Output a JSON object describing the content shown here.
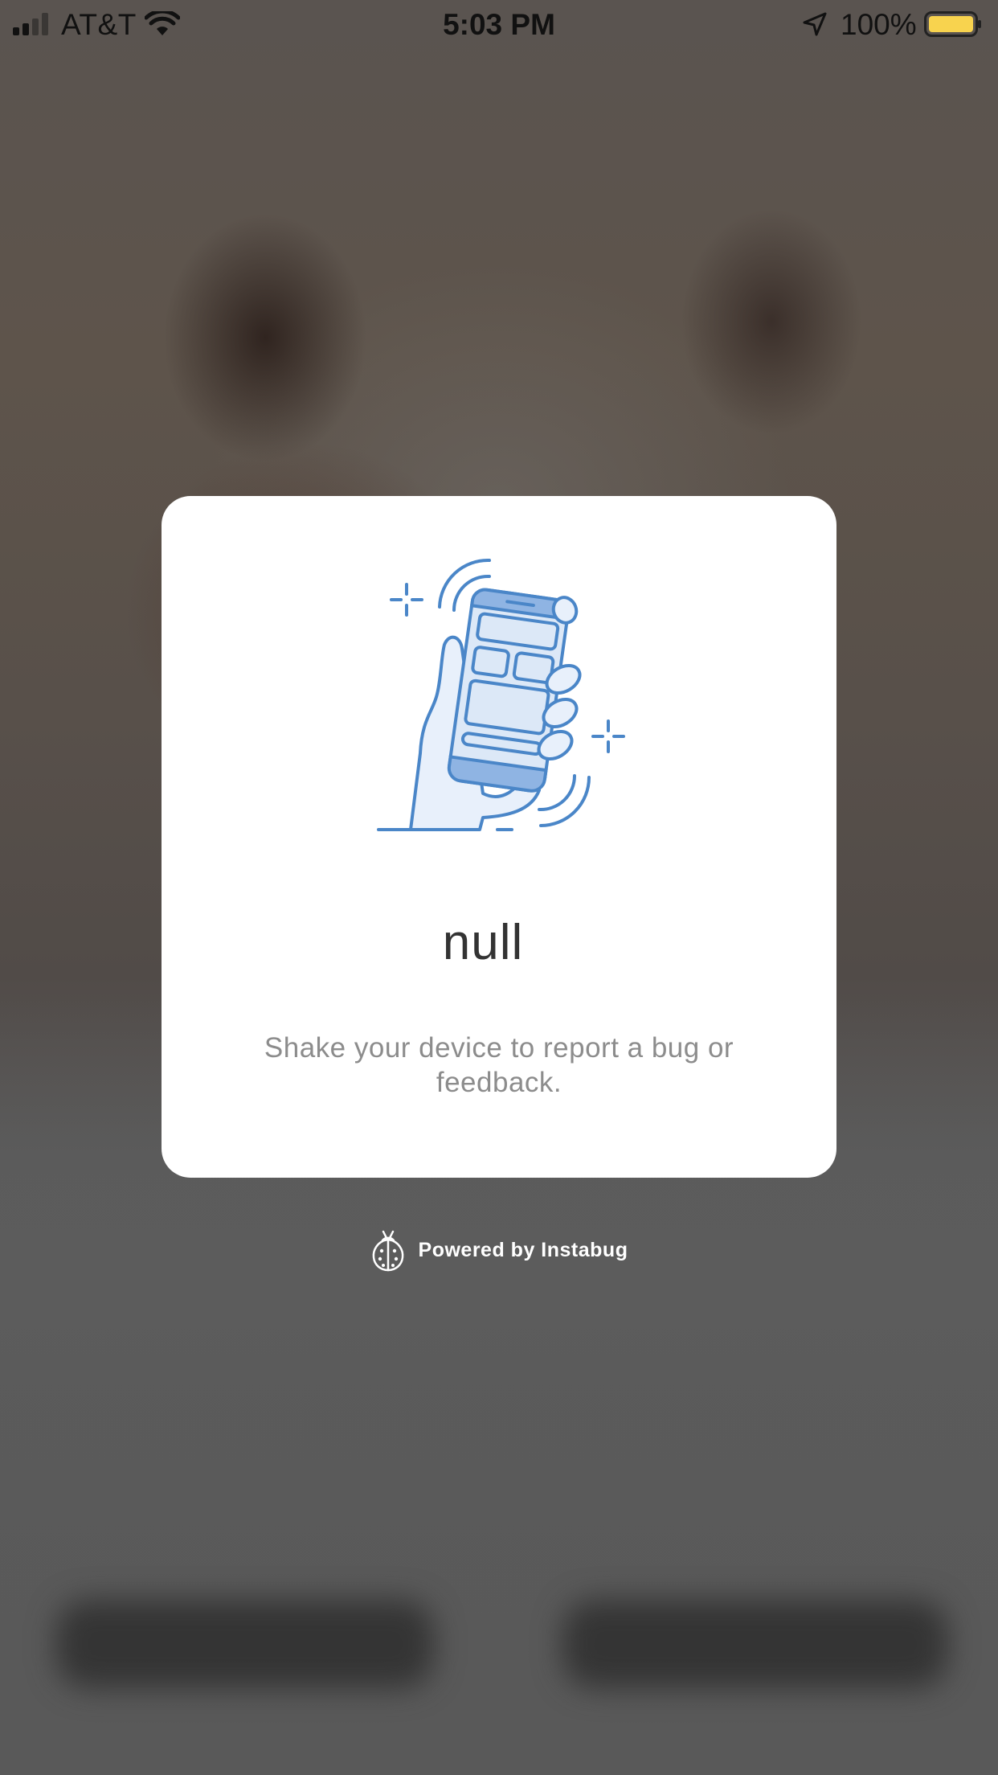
{
  "status_bar": {
    "carrier": "AT&T",
    "time": "5:03 PM",
    "battery_percent": "100%",
    "battery_level": 1.0,
    "signal_bars": 2,
    "icons": [
      "signal-icon",
      "wifi-icon",
      "location-icon",
      "battery-icon"
    ]
  },
  "modal": {
    "illustration": "hand-shaking-phone-icon",
    "title": "null",
    "subtitle": "Shake your device to report a bug or feedback."
  },
  "footer": {
    "icon": "ladybug-icon",
    "powered_by": "Powered by Instabug"
  },
  "colors": {
    "accent": "#4a86c8",
    "accent_fill": "#dce8f7",
    "battery": "#f8d34e",
    "title_text": "#333333",
    "subtitle_text": "#8c8c8c"
  }
}
